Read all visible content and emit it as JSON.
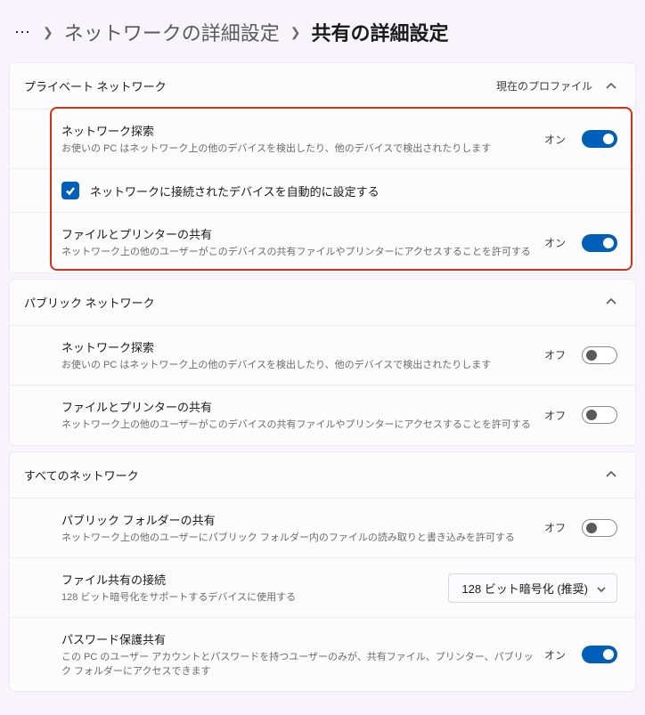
{
  "breadcrumb": {
    "parent": "ネットワークの詳細設定",
    "current": "共有の詳細設定"
  },
  "sections": {
    "private": {
      "title": "プライベート ネットワーク",
      "badge": "現在のプロファイル",
      "discovery": {
        "title": "ネットワーク探索",
        "desc": "お使いの PC はネットワーク上の他のデバイスを検出したり、他のデバイスで検出されたりします",
        "state": "オン"
      },
      "autoconfig": {
        "label": "ネットワークに接続されたデバイスを自動的に設定する"
      },
      "fileshare": {
        "title": "ファイルとプリンターの共有",
        "desc": "ネットワーク上の他のユーザーがこのデバイスの共有ファイルやプリンターにアクセスすることを許可する",
        "state": "オン"
      }
    },
    "public": {
      "title": "パブリック ネットワーク",
      "discovery": {
        "title": "ネットワーク探索",
        "desc": "お使いの PC はネットワーク上の他のデバイスを検出したり、他のデバイスで検出されたりします",
        "state": "オフ"
      },
      "fileshare": {
        "title": "ファイルとプリンターの共有",
        "desc": "ネットワーク上の他のユーザーがこのデバイスの共有ファイルやプリンターにアクセスすることを許可する",
        "state": "オフ"
      }
    },
    "all": {
      "title": "すべてのネットワーク",
      "publicfolder": {
        "title": "パブリック フォルダーの共有",
        "desc": "ネットワーク上の他のユーザーにパブリック フォルダー内のファイルの読み取りと書き込みを許可する",
        "state": "オフ"
      },
      "connection": {
        "title": "ファイル共有の接続",
        "desc": "128 ビット暗号化をサポートするデバイスに使用する",
        "selected": "128 ビット暗号化 (推奨)"
      },
      "password": {
        "title": "パスワード保護共有",
        "desc": "この PC のユーザー アカウントとパスワードを持つユーザーのみが、共有ファイル、プリンター、パブリック フォルダーにアクセスできます",
        "state": "オン"
      }
    }
  }
}
